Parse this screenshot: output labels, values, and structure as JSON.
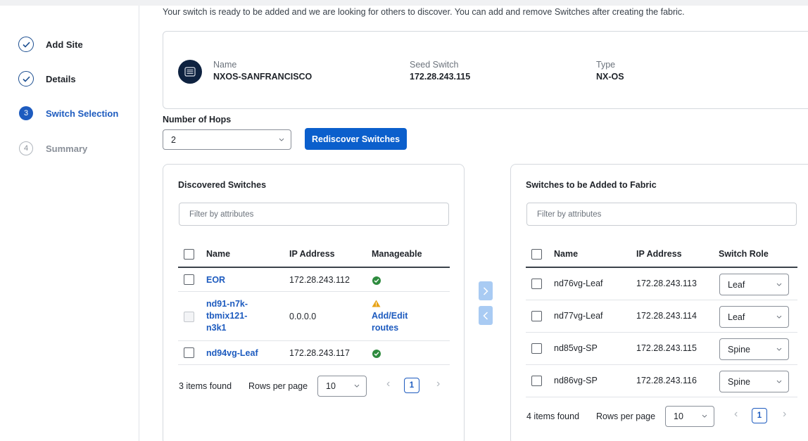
{
  "wizard": {
    "steps": [
      {
        "num": "1",
        "label": "Add Site",
        "state": "done"
      },
      {
        "num": "2",
        "label": "Details",
        "state": "done"
      },
      {
        "num": "3",
        "label": "Switch Selection",
        "state": "current"
      },
      {
        "num": "4",
        "label": "Summary",
        "state": "todo"
      }
    ]
  },
  "intro": "Your switch is ready to be added and we are looking for others to discover. You can add and remove Switches after creating the fabric.",
  "seed": {
    "name_label": "Name",
    "name_value": "NXOS-SANFRANCISCO",
    "seed_label": "Seed Switch",
    "seed_value": "172.28.243.115",
    "type_label": "Type",
    "type_value": "NX-OS",
    "icon": "switch-icon"
  },
  "hops": {
    "label": "Number of Hops",
    "value": "2"
  },
  "rediscover_label": "Rediscover Switches",
  "discovered": {
    "title": "Discovered Switches",
    "filter_placeholder": "Filter by attributes",
    "columns": [
      "Name",
      "IP Address",
      "Manageable"
    ],
    "rows": [
      {
        "name": "EOR",
        "ip": "172.28.243.112",
        "manageable": "ok"
      },
      {
        "name_lines": [
          "nd91-n7k-",
          "tbmix121-",
          "n3k1"
        ],
        "ip": "0.0.0.0",
        "manageable": "warning",
        "action_lines": [
          "Add/Edit",
          "routes"
        ]
      },
      {
        "name": "nd94vg-Leaf",
        "ip": "172.28.243.117",
        "manageable": "ok"
      }
    ],
    "items_found": "3 items found",
    "rows_per_page_label": "Rows per page",
    "rows_per_page": "10",
    "page": "1"
  },
  "to_add": {
    "title": "Switches to be Added to Fabric",
    "filter_placeholder": "Filter by attributes",
    "columns": [
      "Name",
      "IP Address",
      "Switch Role"
    ],
    "rows": [
      {
        "name": "nd76vg-Leaf",
        "ip": "172.28.243.113",
        "role": "Leaf"
      },
      {
        "name": "nd77vg-Leaf",
        "ip": "172.28.243.114",
        "role": "Leaf"
      },
      {
        "name": "nd85vg-SP",
        "ip": "172.28.243.115",
        "role": "Spine"
      },
      {
        "name": "nd86vg-SP",
        "ip": "172.28.243.116",
        "role": "Spine"
      }
    ],
    "items_found": "4 items found",
    "rows_per_page_label": "Rows per page",
    "rows_per_page": "10",
    "page": "1"
  },
  "colors": {
    "primary": "#0b5fcc",
    "link": "#1d5bbf",
    "success": "#2e8b3e",
    "warning": "#e8a317",
    "seed_icon_bg": "#0e2240"
  }
}
